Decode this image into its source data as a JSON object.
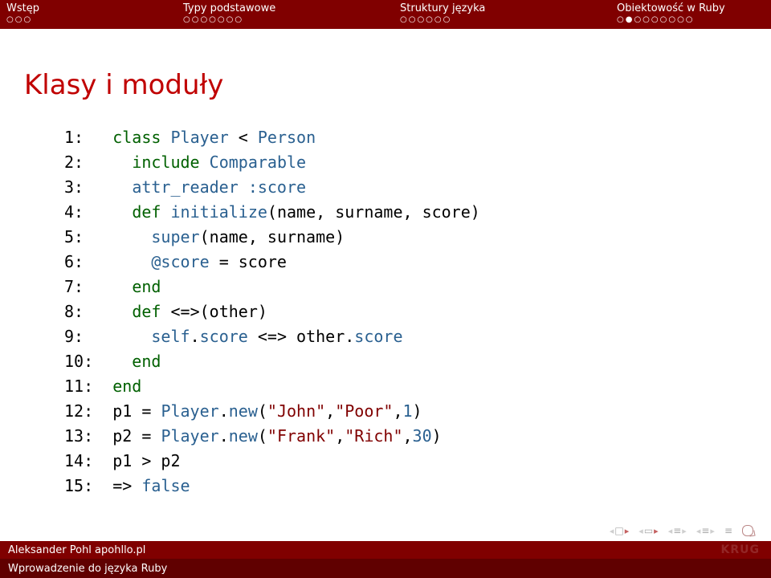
{
  "header": {
    "col1": {
      "label": "Wstęp",
      "dots": "○○○"
    },
    "col2": {
      "label": "Typy podstawowe",
      "dots": "○○○○○○○"
    },
    "col3": {
      "label": "Struktury języka",
      "dots": "○○○○○○"
    },
    "col4": {
      "label": "Obiektowość w Ruby",
      "dots": "○●○○○○○○○"
    }
  },
  "title": "Klasy i moduły",
  "code": {
    "l1": {
      "n": "1:",
      "a": "class",
      "b": "Player",
      "c": "<",
      "d": "Person"
    },
    "l2": {
      "n": "2:",
      "a": "include",
      "b": "Comparable"
    },
    "l3": {
      "n": "3:",
      "a": "attr_reader",
      "b": ":score"
    },
    "l4": {
      "n": "4:",
      "a": "def",
      "b": "initialize",
      "c": "(name, surname, score)"
    },
    "l5": {
      "n": "5:",
      "a": "super",
      "b": "(name, surname)"
    },
    "l6": {
      "n": "6:",
      "a": "@score",
      "b": "= score"
    },
    "l7": {
      "n": "7:",
      "a": "end"
    },
    "l8": {
      "n": "8:",
      "a": "def",
      "b": "<=>(other)"
    },
    "l9": {
      "n": "9:",
      "a": "self",
      "b": ".",
      "c": "score",
      "d": "<=> other.",
      "e": "score"
    },
    "l10": {
      "n": "10:",
      "a": "end"
    },
    "l11": {
      "n": "11:",
      "a": "end"
    },
    "l12": {
      "n": "12:",
      "a": "p1 =",
      "b": "Player",
      "c": ".",
      "d": "new",
      "e": "(",
      "f": "\"John\"",
      "g": ",",
      "h": "\"Poor\"",
      "i": ",",
      "j": "1",
      "k": ")"
    },
    "l13": {
      "n": "13:",
      "a": "p2 =",
      "b": "Player",
      "c": ".",
      "d": "new",
      "e": "(",
      "f": "\"Frank\"",
      "g": ",",
      "h": "\"Rich\"",
      "i": ",",
      "j": "30",
      "k": ")"
    },
    "l14": {
      "n": "14:",
      "a": "p1 > p2"
    },
    "l15": {
      "n": "15:",
      "a": "=>",
      "b": "false"
    }
  },
  "footer": {
    "author": "Aleksander Pohl apohllo.pl",
    "brand": "KRUG",
    "subtitle": "Wprowadzenie do języka Ruby"
  }
}
